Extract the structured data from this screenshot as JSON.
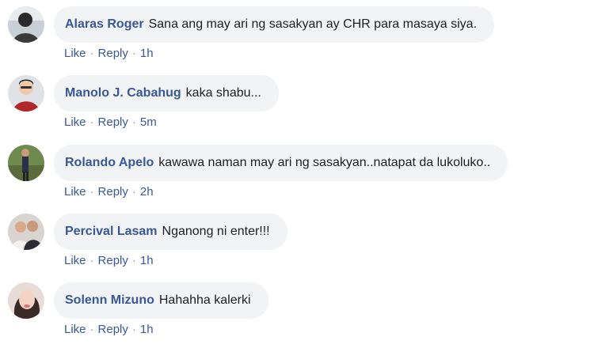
{
  "comments": [
    {
      "author": "Alaras Roger",
      "text": "Sana ang may ari ng sasakyan ay CHR para masaya siya.",
      "like_label": "Like",
      "reply_label": "Reply",
      "separator": "·",
      "time": "1h",
      "avatar_icon": "user-photo-avatar"
    },
    {
      "author": "Manolo J. Cabahug",
      "text": "kaka shabu...",
      "like_label": "Like",
      "reply_label": "Reply",
      "separator": "·",
      "time": "5m",
      "avatar_icon": "user-photo-avatar"
    },
    {
      "author": "Rolando Apelo",
      "text": "kawawa naman may ari ng sasakyan..natapat da lukoluko..",
      "like_label": "Like",
      "reply_label": "Reply",
      "separator": "·",
      "time": "2h",
      "avatar_icon": "user-photo-avatar"
    },
    {
      "author": "Percival Lasam",
      "text": "Nganong ni enter!!!",
      "like_label": "Like",
      "reply_label": "Reply",
      "separator": "·",
      "time": "1h",
      "avatar_icon": "user-photo-avatar"
    },
    {
      "author": "Solenn Mizuno",
      "text": "Hahahha kalerki",
      "like_label": "Like",
      "reply_label": "Reply",
      "separator": "·",
      "time": "1h",
      "avatar_icon": "user-photo-avatar"
    }
  ],
  "colors": {
    "author": "#385898",
    "bubble_bg": "#f2f3f5",
    "text": "#1c1e21",
    "action_link": "#385898",
    "separator": "#90949c"
  }
}
